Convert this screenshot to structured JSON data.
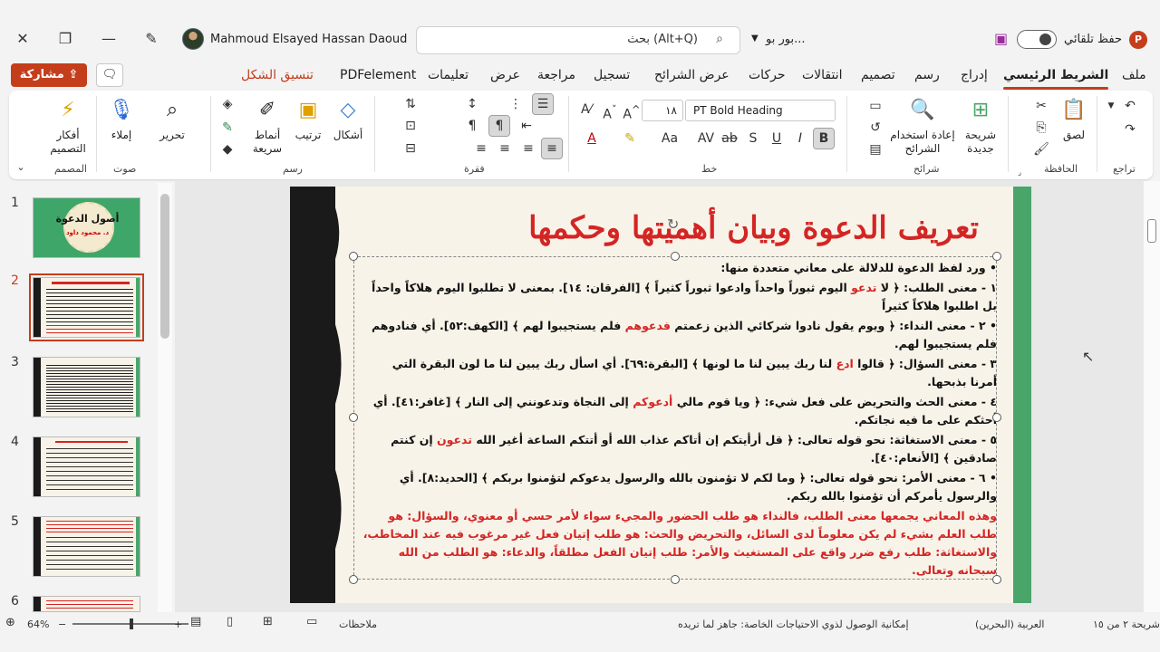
{
  "titlebar": {
    "user_name": "Mahmoud Elsayed Hassan Daoud",
    "search_placeholder": "بحث (Alt+Q)",
    "file_name": "بور بو...",
    "autosave_label": "حفظ تلقائي"
  },
  "tabs": [
    "ملف",
    "الشريط الرئيسي",
    "إدراج",
    "رسم",
    "تصميم",
    "انتقالات",
    "حركات",
    "عرض الشرائح",
    "تسجيل",
    "مراجعة",
    "عرض",
    "تعليمات",
    "PDFelement",
    "تنسيق الشكل"
  ],
  "share_label": "مشاركة",
  "ribbon": {
    "groups": {
      "undo": "تراجع",
      "clipboard": "الحافظة",
      "slides": "شرائح",
      "font": "خط",
      "paragraph": "فقرة",
      "drawing": "رسم",
      "voice": "صوت",
      "designer": "المصمم"
    },
    "paste": "لصق",
    "new_slide": "شريحة جديدة",
    "reuse_slides": "إعادة استخدام الشرائح",
    "font_name": "PT Bold Heading",
    "font_size": "١٨",
    "shapes": "أشكال",
    "arrange": "ترتيب",
    "quick_styles": "أنماط سريعة",
    "editing": "تحرير",
    "dictate": "إملاء",
    "design_ideas": "أفكار التصميم"
  },
  "thumbnails": {
    "numbers": [
      "1",
      "2",
      "3",
      "4",
      "5",
      "6"
    ],
    "thumb1_title": "أصول الدعوة",
    "thumb1_sub": "د. محمود داود"
  },
  "slide": {
    "title": "تعريف الدعوة وبيان أهميتها وحكمها",
    "intro": "ورد لفظ الدعوة للدلالة على معاني متعددة منها:",
    "items": [
      {
        "pre": "١ - معنى الطلب: ﴿ لا ",
        "red": "تدعو",
        "post": " اليوم ثبوراً واحداً وادعوا ثبوراً كثيراً ﴾ [الفرقان: ١٤]. بمعنى لا تطلبوا اليوم هلاكاً واحداً بل اطلبوا هلاكاً كثيراً"
      },
      {
        "pre": "٢ - معنى النداء: ﴿ ويوم يقول نادوا شركائي الذين زعمتم ",
        "red": "فدعوهم",
        "post": " فلم يستجيبوا لهم ﴾ [الكهف:٥٢]. أي فنادوهم فلم يستجيبوا لهم."
      },
      {
        "pre": "٣ - معنى السؤال: ﴿ قالوا ",
        "red": "ادع",
        "post": " لنا ربك يبين لنا ما لونها ﴾ [البقرة:٦٩]. أي اسأل ربك يبين لنا ما لون البقرة التي أمرنا بذبحها."
      },
      {
        "pre": "٤ - معنى الحث والتحريض على فعل شيء: ﴿ ويا قوم مالي ",
        "red": "أدعوكم",
        "post": " إلى النجاة وتدعونني إلى النار ﴾ [غافر:٤١]. أي أحثكم على ما فيه نجاتكم."
      },
      {
        "pre": "٥ - معنى الاستغاثة: نحو قوله تعالى: ﴿ قل أرأيتكم إن أتاكم عذاب الله أو أتتكم الساعة أغير الله ",
        "red": "تدعون",
        "post": " إن كنتم صادقين ﴾ [الأنعام:٤٠]."
      },
      {
        "pre": "٦ - معنى الأمر: نحو قوله تعالى: ﴿ وما لكم لا تؤمنون بالله والرسول يدعوكم لتؤمنوا بربكم ﴾ [الحديد:٨]. أي والرسول يأمركم أن تؤمنوا بالله ربكم.",
        "red": "",
        "post": ""
      }
    ],
    "summary": "وهذه المعاني يجمعها معنى الطلب، فالنداء هو طلب الحضور والمجيء سواء لأمر حسي أو معنوي، والسؤال: هو طلب العلم بشيء لم يكن معلوماً لدى السائل، والتحريض والحث: هو طلب إتيان فعل غير مرغوب فيه عند المخاطب، والاستغاثة: طلب رفع ضرر واقع على المستغيث والأمر: طلب إتيان الفعل مطلقاً، والدعاء: هو الطلب من الله سبحانه وتعالى."
  },
  "statusbar": {
    "slide_count": "شريحة ٢ من ١٥",
    "language": "العربية (البحرين)",
    "accessibility": "إمكانية الوصول لذوي الاحتياجات الخاصة: جاهز لما تريده",
    "notes": "ملاحظات",
    "zoom": "64%"
  },
  "colors": {
    "accent": "#c43e1c",
    "slide_title": "#d42525",
    "slide_band": "#4aa56a"
  }
}
